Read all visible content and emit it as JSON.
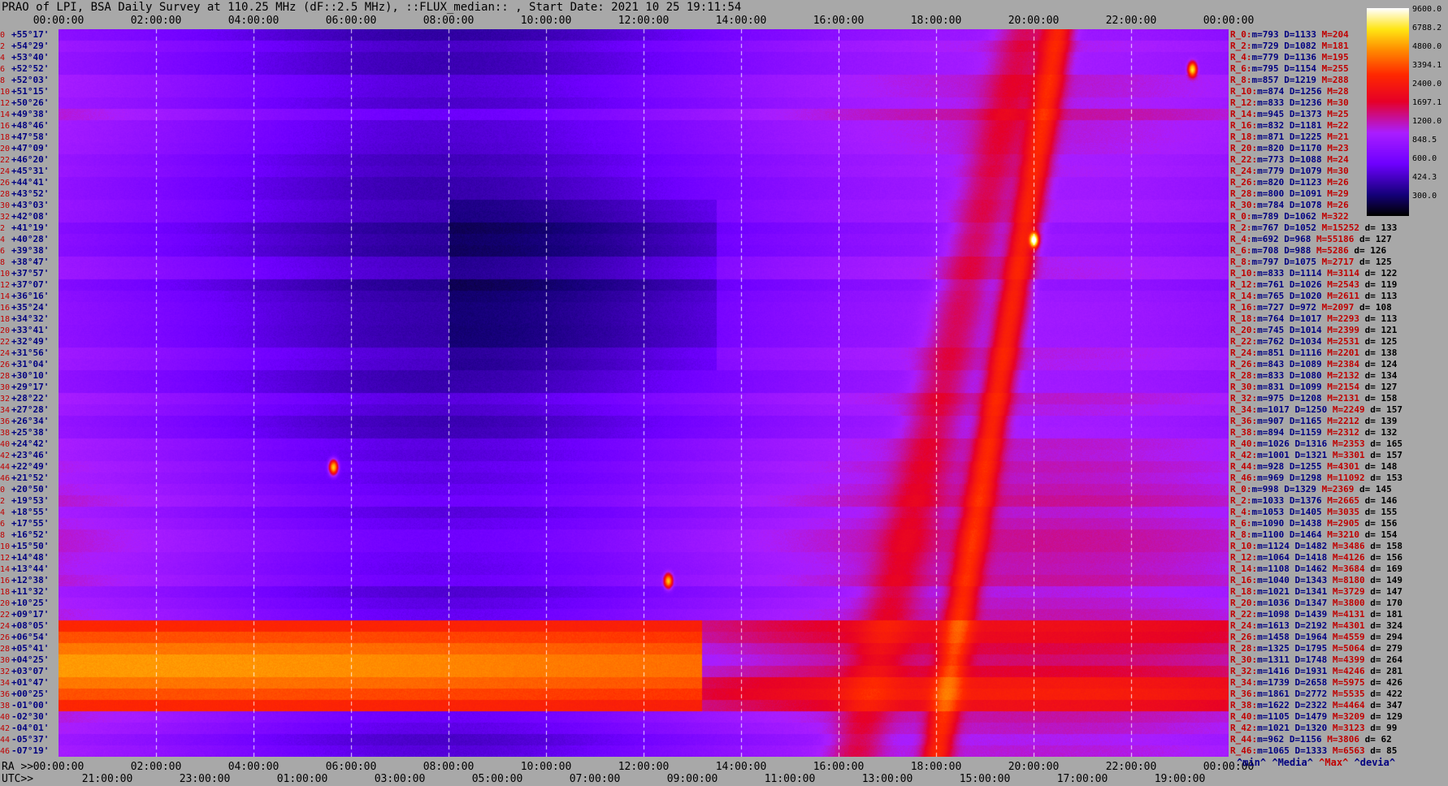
{
  "title": "PRAO of LPI, BSA Daily Survey at 110.25 MHz (dF::2.5 MHz), ::FLUX_median:: , Start Date: 2021 10 25 19:11:54",
  "axis": {
    "top_ticks": [
      "00:00:00",
      "02:00:00",
      "04:00:00",
      "06:00:00",
      "08:00:00",
      "10:00:00",
      "12:00:00",
      "14:00:00",
      "16:00:00",
      "18:00:00",
      "20:00:00",
      "22:00:00",
      "00:00:00"
    ],
    "ra_label": "RA >>",
    "ra_ticks": [
      "00:00:00",
      "02:00:00",
      "04:00:00",
      "06:00:00",
      "08:00:00",
      "10:00:00",
      "12:00:00",
      "14:00:00",
      "16:00:00",
      "18:00:00",
      "20:00:00",
      "22:00:00",
      "00:00:00"
    ],
    "utc_label": "UTC>>",
    "utc_ticks": [
      "21:00:00",
      "23:00:00",
      "01:00:00",
      "03:00:00",
      "05:00:00",
      "07:00:00",
      "09:00:00",
      "11:00:00",
      "13:00:00",
      "15:00:00",
      "17:00:00",
      "19:00:00"
    ]
  },
  "colorbar": {
    "labels": [
      "9600.0",
      "6788.2",
      "4800.0",
      "3394.1",
      "2400.0",
      "1697.1",
      "1200.0",
      "848.5",
      "600.0",
      "424.3",
      "300.0"
    ]
  },
  "legend": {
    "min": "^min^",
    "median": "^Media^",
    "max": "^Max^",
    "devia": "^devia^"
  },
  "chart_data": {
    "type": "heatmap",
    "title": "PRAO of LPI, BSA Daily Survey at 110.25 MHz (dF::2.5 MHz), ::FLUX_median:: , Start Date: 2021 10 25 19:11:54",
    "xlabel": "RA",
    "x_range": [
      "00:00:00",
      "24:00:00"
    ],
    "zlim": [
      300,
      9600
    ],
    "color_scale": "log",
    "declinations": [
      {
        "i": "0",
        "dec": "+55°17'"
      },
      {
        "i": "2",
        "dec": "+54°29'"
      },
      {
        "i": "4",
        "dec": "+53°40'"
      },
      {
        "i": "6",
        "dec": "+52°52'"
      },
      {
        "i": "8",
        "dec": "+52°03'"
      },
      {
        "i": "10",
        "dec": "+51°15'"
      },
      {
        "i": "12",
        "dec": "+50°26'"
      },
      {
        "i": "14",
        "dec": "+49°38'"
      },
      {
        "i": "16",
        "dec": "+48°46'"
      },
      {
        "i": "18",
        "dec": "+47°58'"
      },
      {
        "i": "20",
        "dec": "+47°09'"
      },
      {
        "i": "22",
        "dec": "+46°20'"
      },
      {
        "i": "24",
        "dec": "+45°31'"
      },
      {
        "i": "26",
        "dec": "+44°41'"
      },
      {
        "i": "28",
        "dec": "+43°52'"
      },
      {
        "i": "30",
        "dec": "+43°03'"
      },
      {
        "i": "32",
        "dec": "+42°08'"
      },
      {
        "i": "2",
        "dec": "+41°19'"
      },
      {
        "i": "4",
        "dec": "+40°28'"
      },
      {
        "i": "6",
        "dec": "+39°38'"
      },
      {
        "i": "8",
        "dec": "+38°47'"
      },
      {
        "i": "10",
        "dec": "+37°57'"
      },
      {
        "i": "12",
        "dec": "+37°07'"
      },
      {
        "i": "14",
        "dec": "+36°16'"
      },
      {
        "i": "16",
        "dec": "+35°24'"
      },
      {
        "i": "18",
        "dec": "+34°32'"
      },
      {
        "i": "20",
        "dec": "+33°41'"
      },
      {
        "i": "22",
        "dec": "+32°49'"
      },
      {
        "i": "24",
        "dec": "+31°56'"
      },
      {
        "i": "26",
        "dec": "+31°04'"
      },
      {
        "i": "28",
        "dec": "+30°10'"
      },
      {
        "i": "30",
        "dec": "+29°17'"
      },
      {
        "i": "32",
        "dec": "+28°22'"
      },
      {
        "i": "34",
        "dec": "+27°28'"
      },
      {
        "i": "36",
        "dec": "+26°34'"
      },
      {
        "i": "38",
        "dec": "+25°38'"
      },
      {
        "i": "40",
        "dec": "+24°42'"
      },
      {
        "i": "42",
        "dec": "+23°46'"
      },
      {
        "i": "44",
        "dec": "+22°49'"
      },
      {
        "i": "46",
        "dec": "+21°52'"
      },
      {
        "i": "0",
        "dec": "+20°50'"
      },
      {
        "i": "2",
        "dec": "+19°53'"
      },
      {
        "i": "4",
        "dec": "+18°55'"
      },
      {
        "i": "6",
        "dec": "+17°55'"
      },
      {
        "i": "8",
        "dec": "+16°52'"
      },
      {
        "i": "10",
        "dec": "+15°50'"
      },
      {
        "i": "12",
        "dec": "+14°48'"
      },
      {
        "i": "14",
        "dec": "+13°44'"
      },
      {
        "i": "16",
        "dec": "+12°38'"
      },
      {
        "i": "18",
        "dec": "+11°32'"
      },
      {
        "i": "20",
        "dec": "+10°25'"
      },
      {
        "i": "22",
        "dec": "+09°17'"
      },
      {
        "i": "24",
        "dec": "+08°05'"
      },
      {
        "i": "26",
        "dec": "+06°54'"
      },
      {
        "i": "28",
        "dec": "+05°41'"
      },
      {
        "i": "30",
        "dec": "+04°25'"
      },
      {
        "i": "32",
        "dec": "+03°07'"
      },
      {
        "i": "34",
        "dec": "+01°47'"
      },
      {
        "i": "36",
        "dec": "+00°25'"
      },
      {
        "i": "38",
        "dec": "-01°00'"
      },
      {
        "i": "40",
        "dec": "-02°30'"
      },
      {
        "i": "42",
        "dec": "-04°01'"
      },
      {
        "i": "44",
        "dec": "-05°37'"
      },
      {
        "i": "46",
        "dec": "-07°19'"
      }
    ],
    "row_stats": [
      {
        "r": "R_0:",
        "min": "793",
        "med": "1133",
        "max": "204",
        "dev": ""
      },
      {
        "r": "R_2:",
        "min": "729",
        "med": "1082",
        "max": "181",
        "dev": ""
      },
      {
        "r": "R_4:",
        "min": "779",
        "med": "1136",
        "max": "195",
        "dev": ""
      },
      {
        "r": "R_6:",
        "min": "795",
        "med": "1154",
        "max": "255",
        "dev": ""
      },
      {
        "r": "R_8:",
        "min": "857",
        "med": "1219",
        "max": "288",
        "dev": ""
      },
      {
        "r": "R_10:",
        "min": "874",
        "med": "1256",
        "max": "28",
        "dev": ""
      },
      {
        "r": "R_12:",
        "min": "833",
        "med": "1236",
        "max": "30",
        "dev": ""
      },
      {
        "r": "R_14:",
        "min": "945",
        "med": "1373",
        "max": "25",
        "dev": ""
      },
      {
        "r": "R_16:",
        "min": "832",
        "med": "1181",
        "max": "22",
        "dev": ""
      },
      {
        "r": "R_18:",
        "min": "871",
        "med": "1225",
        "max": "21",
        "dev": ""
      },
      {
        "r": "R_20:",
        "min": "820",
        "med": "1170",
        "max": "23",
        "dev": ""
      },
      {
        "r": "R_22:",
        "min": "773",
        "med": "1088",
        "max": "24",
        "dev": ""
      },
      {
        "r": "R_24:",
        "min": "779",
        "med": "1079",
        "max": "30",
        "dev": ""
      },
      {
        "r": "R_26:",
        "min": "820",
        "med": "1123",
        "max": "26",
        "dev": ""
      },
      {
        "r": "R_28:",
        "min": "800",
        "med": "1091",
        "max": "29",
        "dev": ""
      },
      {
        "r": "R_30:",
        "min": "784",
        "med": "1078",
        "max": "26",
        "dev": ""
      },
      {
        "r": "R_0:",
        "min": "789",
        "med": "1062",
        "max": "322",
        "dev": ""
      },
      {
        "r": "R_2:",
        "min": "767",
        "med": "1052",
        "max": "15252",
        "dev": "133"
      },
      {
        "r": "R_4:",
        "min": "692",
        "med": "968",
        "max": "55186",
        "dev": "127"
      },
      {
        "r": "R_6:",
        "min": "708",
        "med": "988",
        "max": "5286",
        "dev": "126"
      },
      {
        "r": "R_8:",
        "min": "797",
        "med": "1075",
        "max": "2717",
        "dev": "125"
      },
      {
        "r": "R_10:",
        "min": "833",
        "med": "1114",
        "max": "3114",
        "dev": "122"
      },
      {
        "r": "R_12:",
        "min": "761",
        "med": "1026",
        "max": "2543",
        "dev": "119"
      },
      {
        "r": "R_14:",
        "min": "765",
        "med": "1020",
        "max": "2611",
        "dev": "113"
      },
      {
        "r": "R_16:",
        "min": "727",
        "med": "972",
        "max": "2097",
        "dev": "108"
      },
      {
        "r": "R_18:",
        "min": "764",
        "med": "1017",
        "max": "2293",
        "dev": "113"
      },
      {
        "r": "R_20:",
        "min": "745",
        "med": "1014",
        "max": "2399",
        "dev": "121"
      },
      {
        "r": "R_22:",
        "min": "762",
        "med": "1034",
        "max": "2531",
        "dev": "125"
      },
      {
        "r": "R_24:",
        "min": "851",
        "med": "1116",
        "max": "2201",
        "dev": "138"
      },
      {
        "r": "R_26:",
        "min": "843",
        "med": "1089",
        "max": "2384",
        "dev": "124"
      },
      {
        "r": "R_28:",
        "min": "833",
        "med": "1080",
        "max": "2132",
        "dev": "134"
      },
      {
        "r": "R_30:",
        "min": "831",
        "med": "1099",
        "max": "2154",
        "dev": "127"
      },
      {
        "r": "R_32:",
        "min": "975",
        "med": "1208",
        "max": "2131",
        "dev": "158"
      },
      {
        "r": "R_34:",
        "min": "1017",
        "med": "1250",
        "max": "2249",
        "dev": "157"
      },
      {
        "r": "R_36:",
        "min": "907",
        "med": "1165",
        "max": "2212",
        "dev": "139"
      },
      {
        "r": "R_38:",
        "min": "894",
        "med": "1159",
        "max": "2312",
        "dev": "132"
      },
      {
        "r": "R_40:",
        "min": "1026",
        "med": "1316",
        "max": "2353",
        "dev": "165"
      },
      {
        "r": "R_42:",
        "min": "1001",
        "med": "1321",
        "max": "3301",
        "dev": "157"
      },
      {
        "r": "R_44:",
        "min": "928",
        "med": "1255",
        "max": "4301",
        "dev": "148"
      },
      {
        "r": "R_46:",
        "min": "969",
        "med": "1298",
        "max": "11092",
        "dev": "153"
      },
      {
        "r": "R_0:",
        "min": "998",
        "med": "1329",
        "max": "2369",
        "dev": "145"
      },
      {
        "r": "R_2:",
        "min": "1033",
        "med": "1376",
        "max": "2665",
        "dev": "146"
      },
      {
        "r": "R_4:",
        "min": "1053",
        "med": "1405",
        "max": "3035",
        "dev": "155"
      },
      {
        "r": "R_6:",
        "min": "1090",
        "med": "1438",
        "max": "2905",
        "dev": "156"
      },
      {
        "r": "R_8:",
        "min": "1100",
        "med": "1464",
        "max": "3210",
        "dev": "154"
      },
      {
        "r": "R_10:",
        "min": "1124",
        "med": "1482",
        "max": "3486",
        "dev": "158"
      },
      {
        "r": "R_12:",
        "min": "1064",
        "med": "1418",
        "max": "4126",
        "dev": "156"
      },
      {
        "r": "R_14:",
        "min": "1108",
        "med": "1462",
        "max": "3684",
        "dev": "169"
      },
      {
        "r": "R_16:",
        "min": "1040",
        "med": "1343",
        "max": "8180",
        "dev": "149"
      },
      {
        "r": "R_18:",
        "min": "1021",
        "med": "1341",
        "max": "3729",
        "dev": "147"
      },
      {
        "r": "R_20:",
        "min": "1036",
        "med": "1347",
        "max": "3800",
        "dev": "170"
      },
      {
        "r": "R_22:",
        "min": "1098",
        "med": "1439",
        "max": "4131",
        "dev": "181"
      },
      {
        "r": "R_24:",
        "min": "1613",
        "med": "2192",
        "max": "4301",
        "dev": "324"
      },
      {
        "r": "R_26:",
        "min": "1458",
        "med": "1964",
        "max": "4559",
        "dev": "294"
      },
      {
        "r": "R_28:",
        "min": "1325",
        "med": "1795",
        "max": "5064",
        "dev": "279"
      },
      {
        "r": "R_30:",
        "min": "1311",
        "med": "1748",
        "max": "4399",
        "dev": "264"
      },
      {
        "r": "R_32:",
        "min": "1416",
        "med": "1931",
        "max": "4246",
        "dev": "281"
      },
      {
        "r": "R_34:",
        "min": "1739",
        "med": "2658",
        "max": "5975",
        "dev": "426"
      },
      {
        "r": "R_36:",
        "min": "1861",
        "med": "2772",
        "max": "5535",
        "dev": "422"
      },
      {
        "r": "R_38:",
        "min": "1622",
        "med": "2322",
        "max": "4464",
        "dev": "347"
      },
      {
        "r": "R_40:",
        "min": "1105",
        "med": "1479",
        "max": "3209",
        "dev": "129"
      },
      {
        "r": "R_42:",
        "min": "1021",
        "med": "1320",
        "max": "3123",
        "dev": "99"
      },
      {
        "r": "R_44:",
        "min": "962",
        "med": "1156",
        "max": "3806",
        "dev": "62"
      },
      {
        "r": "R_46:",
        "min": "1065",
        "med": "1333",
        "max": "6563",
        "dev": "85"
      }
    ],
    "features": {
      "bright_band_dec": [
        "+08°05'",
        "-01°00'"
      ],
      "ridge_ra": [
        [
          "20:30:00",
          "+55°17'"
        ],
        [
          "18:00:00",
          "-07°19'"
        ]
      ],
      "point_sources": [
        {
          "ra": "20:00:00",
          "dec": "+40°28'",
          "peak": 9600
        },
        {
          "ra": "23:15:00",
          "dec": "+52°52'",
          "peak": 6000
        },
        {
          "ra": "05:38:00",
          "dec": "+22°00'",
          "peak": 5500
        },
        {
          "ra": "12:30:00",
          "dec": "+12°38'",
          "peak": 5000
        }
      ]
    }
  }
}
